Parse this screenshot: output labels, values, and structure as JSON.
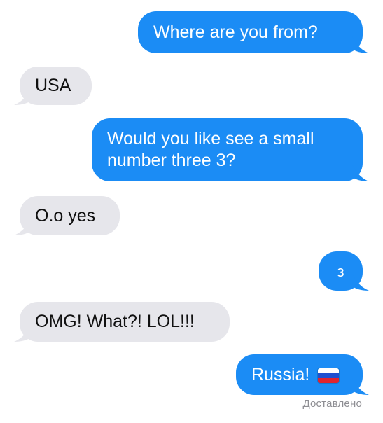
{
  "messages": [
    {
      "direction": "outgoing",
      "text": "Where are you from?"
    },
    {
      "direction": "incoming",
      "text": "USA"
    },
    {
      "direction": "outgoing",
      "lines": [
        "Would you like see a small",
        "number three 3?"
      ]
    },
    {
      "direction": "incoming",
      "text": "O.o yes"
    },
    {
      "direction": "outgoing",
      "text": "з"
    },
    {
      "direction": "incoming",
      "text": "OMG! What?! LOL!!!"
    },
    {
      "direction": "outgoing",
      "text": "Russia!",
      "emoji": "russia-flag-icon"
    }
  ],
  "status": {
    "delivered_label": "Доставлено"
  },
  "colors": {
    "outgoing_bubble": "#1b8cf5",
    "incoming_bubble": "#e6e6eb",
    "outgoing_text": "#ffffff",
    "incoming_text": "#111111",
    "status_text": "#8e8e93",
    "flag_white": "#ffffff",
    "flag_blue": "#1f4fd0",
    "flag_red": "#e0242f"
  }
}
